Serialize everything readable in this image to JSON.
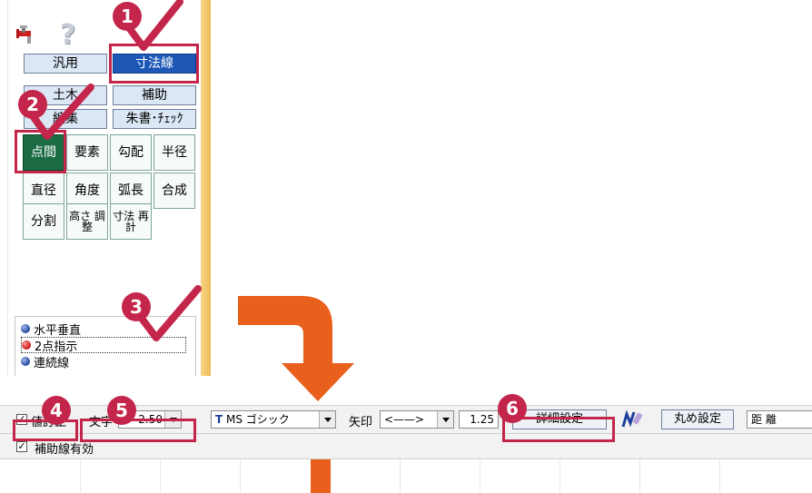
{
  "palette": {
    "tabs": {
      "general": "汎用",
      "dimension": "寸法線",
      "civil": "土木",
      "auxiliary": "補助",
      "edit": "編集",
      "redline": "朱書･ﾁｪｯｸ"
    },
    "commands": [
      {
        "key": "point-interval",
        "label": "点間"
      },
      {
        "key": "element",
        "label": "要素"
      },
      {
        "key": "slope",
        "label": "勾配"
      },
      {
        "key": "radius",
        "label": "半径"
      },
      {
        "key": "diameter",
        "label": "直径"
      },
      {
        "key": "angle",
        "label": "角度"
      },
      {
        "key": "arc-length",
        "label": "弧長"
      },
      {
        "key": "composite",
        "label": "合成"
      },
      {
        "key": "divide",
        "label": "分割"
      },
      {
        "key": "height-adjust",
        "label": "高さ 調整"
      },
      {
        "key": "dimension-recalc",
        "label": "寸法 再計"
      }
    ],
    "modes": [
      {
        "label": "水平垂直",
        "selected": false
      },
      {
        "label": "2点指示",
        "selected": true
      },
      {
        "label": "連続線",
        "selected": false
      }
    ]
  },
  "callouts": [
    "1",
    "2",
    "3",
    "4",
    "5",
    "6"
  ],
  "toolbar": {
    "correction_checkbox": "値訂正",
    "correction_checked": true,
    "text_label": "文字",
    "text_size": "2.50",
    "font_name": "MS ゴシック",
    "arrow_label": "矢印",
    "arrow_style": "<——>",
    "arrow_size": "1.25",
    "detail_settings_button": "詳細設定",
    "rounding_settings_button": "丸め設定",
    "distance_field": "距 離",
    "auxiliary_line_checkbox": "補助線有効",
    "auxiliary_line_checked": true
  },
  "colors": {
    "accent": "#c4254a",
    "arrow": "#e8601c",
    "tab_active": "#1d58b7",
    "cmd_active": "#1b6b43"
  }
}
